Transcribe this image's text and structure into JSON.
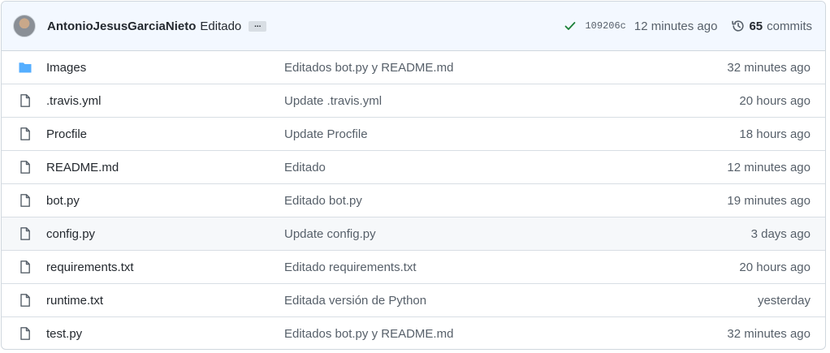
{
  "commit": {
    "author": "AntonioJesusGarciaNieto",
    "message": "Editado",
    "ellipsis": "...",
    "sha": "109206c",
    "time": "12 minutes ago",
    "commit_count": "65",
    "commits_label": "commits"
  },
  "colors": {
    "header_bg": "#f3f8ff",
    "folder": "#54aeff",
    "check": "#1a7f37",
    "muted": "#57606a",
    "border": "#d0d7de"
  },
  "files": [
    {
      "name": "Images",
      "type": "folder",
      "message": "Editados bot.py y README.md",
      "age": "32 minutes ago"
    },
    {
      "name": ".travis.yml",
      "type": "file",
      "message": "Update .travis.yml",
      "age": "20 hours ago"
    },
    {
      "name": "Procfile",
      "type": "file",
      "message": "Update Procfile",
      "age": "18 hours ago"
    },
    {
      "name": "README.md",
      "type": "file",
      "message": "Editado",
      "age": "12 minutes ago"
    },
    {
      "name": "bot.py",
      "type": "file",
      "message": "Editado bot.py",
      "age": "19 minutes ago"
    },
    {
      "name": "config.py",
      "type": "file",
      "message": "Update config.py",
      "age": "3 days ago"
    },
    {
      "name": "requirements.txt",
      "type": "file",
      "message": "Editado requirements.txt",
      "age": "20 hours ago"
    },
    {
      "name": "runtime.txt",
      "type": "file",
      "message": "Editada versión de Python",
      "age": "yesterday"
    },
    {
      "name": "test.py",
      "type": "file",
      "message": "Editados bot.py y README.md",
      "age": "32 minutes ago"
    }
  ]
}
